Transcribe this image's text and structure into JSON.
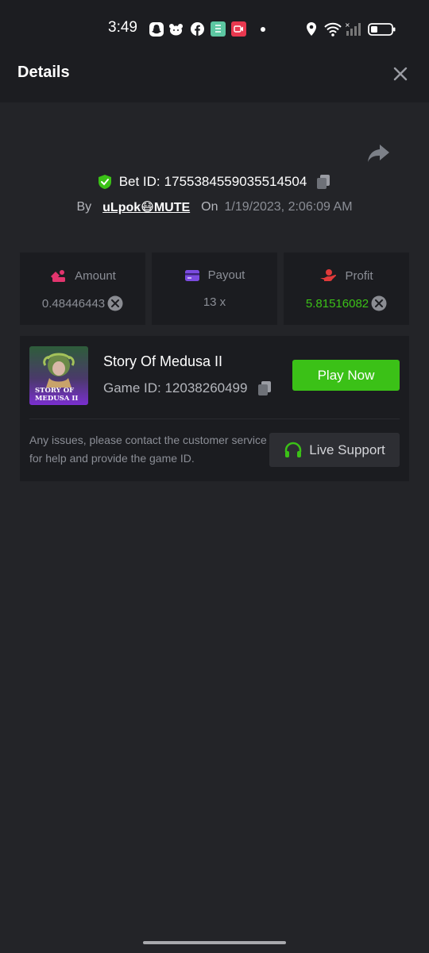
{
  "status_bar": {
    "time": "3:49"
  },
  "header": {
    "title": "Details"
  },
  "bet": {
    "id_label": "Bet ID:",
    "id_value": "1755384559035514504",
    "by_label": "By",
    "user": "uLpok😷MUTE",
    "on_label": "On",
    "date": "1/19/2023, 2:06:09 AM"
  },
  "stats": {
    "amount": {
      "label": "Amount",
      "value": "0.48446443"
    },
    "payout": {
      "label": "Payout",
      "value": "13 x"
    },
    "profit": {
      "label": "Profit",
      "value": "5.81516082"
    }
  },
  "game": {
    "name": "Story Of Medusa II",
    "id_label": "Game ID: 12038260499",
    "thumb_line1": "STORY OF",
    "thumb_line2": "MEDUSA II",
    "play_label": "Play Now",
    "issue_text": "Any issues, please contact the customer service for help and provide the game ID.",
    "support_label": "Live Support"
  },
  "colors": {
    "accent_green": "#3bc117",
    "profit_green": "#3bc117",
    "background": "#232428",
    "card": "#1b1c20"
  }
}
